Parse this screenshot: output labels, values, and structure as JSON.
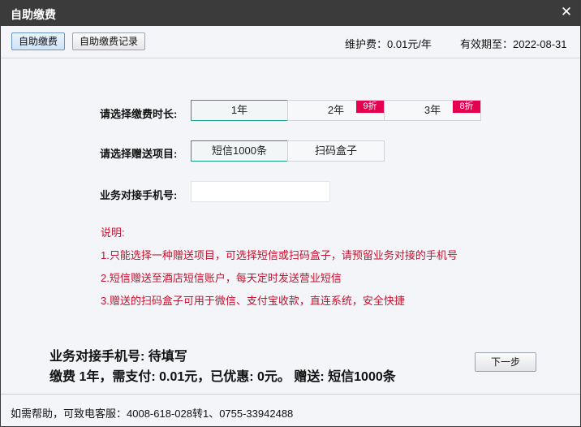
{
  "window": {
    "title": "自助缴费",
    "close_glyph": "✕"
  },
  "toolbar": {
    "tabs": [
      {
        "label": "自助缴费",
        "active": true
      },
      {
        "label": "自助缴费记录",
        "active": false
      }
    ],
    "maintenance_fee": "维护费：0.01元/年",
    "expiry": "有效期至：2022-08-31"
  },
  "form": {
    "duration": {
      "label": "请选择缴费时长:",
      "options": [
        {
          "label": "1年",
          "badge": "",
          "selected": true
        },
        {
          "label": "2年",
          "badge": "9折",
          "selected": false
        },
        {
          "label": "3年",
          "badge": "8折",
          "selected": false
        }
      ]
    },
    "gift": {
      "label": "请选择赠送项目:",
      "options": [
        {
          "label": "短信1000条",
          "selected": true
        },
        {
          "label": "扫码盒子",
          "selected": false
        }
      ]
    },
    "phone": {
      "label": "业务对接手机号:",
      "value": "",
      "placeholder": ""
    }
  },
  "notes": {
    "title": "说明:",
    "items": [
      "1.只能选择一种赠送项目，可选择短信或扫码盒子，请预留业务对接的手机号",
      "2.短信赠送至酒店短信账户，每天定时发送营业短信",
      "3.赠送的扫码盒子可用于微信、支付宝收款，直连系统，安全快捷"
    ]
  },
  "summary": {
    "phone_line": "业务对接手机号: 待填写",
    "payment_line": "缴费 1年，需支付: 0.01元，已优惠: 0元。 赠送:  短信1000条"
  },
  "actions": {
    "next_label": "下一步"
  },
  "footer": {
    "help": "如需帮助，可致电客服：4008-618-028转1、0755-33942488"
  },
  "colors": {
    "accent": "#1aa089",
    "badge": "#e4004f",
    "note": "#c8102e",
    "titlebar": "#3b3b3b"
  }
}
